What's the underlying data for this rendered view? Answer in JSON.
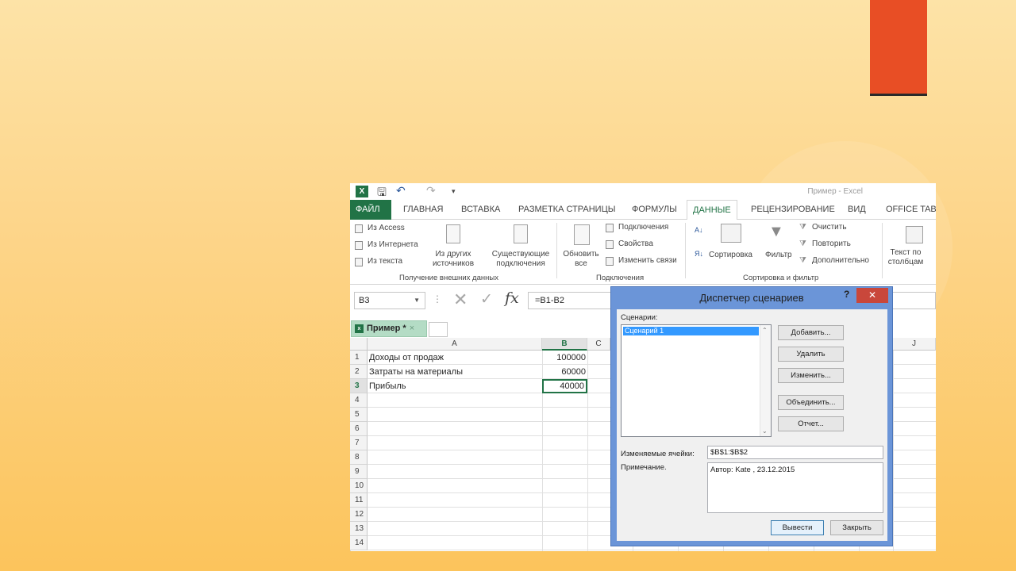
{
  "window": {
    "title": "Пример - Excel"
  },
  "ribbon_tabs": [
    "ФАЙЛ",
    "ГЛАВНАЯ",
    "ВСТАВКА",
    "РАЗМЕТКА СТРАНИЦЫ",
    "ФОРМУЛЫ",
    "ДАННЫЕ",
    "РЕЦЕНЗИРОВАНИЕ",
    "ВИД",
    "OFFICE TAB"
  ],
  "active_tab": "ДАННЫЕ",
  "ribbon": {
    "external": {
      "from_access": "Из Access",
      "from_web": "Из Интернета",
      "from_text": "Из текста",
      "from_other_1": "Из других",
      "from_other_2": "источников",
      "existing_1": "Существующие",
      "existing_2": "подключения",
      "group": "Получение внешних данных"
    },
    "connections": {
      "refresh_1": "Обновить",
      "refresh_2": "все",
      "connections": "Подключения",
      "properties": "Свойства",
      "edit_links": "Изменить связи",
      "group": "Подключения"
    },
    "sort": {
      "sort": "Сортировка",
      "filter": "Фильтр",
      "clear": "Очистить",
      "reapply": "Повторить",
      "advanced": "Дополнительно",
      "group": "Сортировка и фильтр"
    },
    "tools": {
      "text_cols_1": "Текст по",
      "text_cols_2": "столбцам"
    }
  },
  "formula_bar": {
    "name_box": "B3",
    "formula": "=B1-B2"
  },
  "workbook_tab": {
    "label": "Пример *",
    "close": "×"
  },
  "sheet": {
    "columns": [
      "A",
      "B",
      "C",
      "J"
    ],
    "rows": [
      {
        "num": "1",
        "a": "Доходы от продаж",
        "b": "100000"
      },
      {
        "num": "2",
        "a": "Затраты на материалы",
        "b": "60000"
      },
      {
        "num": "3",
        "a": "Прибыль",
        "b": "40000"
      },
      {
        "num": "4",
        "a": "",
        "b": ""
      },
      {
        "num": "5",
        "a": "",
        "b": ""
      },
      {
        "num": "6",
        "a": "",
        "b": ""
      },
      {
        "num": "7",
        "a": "",
        "b": ""
      },
      {
        "num": "8",
        "a": "",
        "b": ""
      },
      {
        "num": "9",
        "a": "",
        "b": ""
      },
      {
        "num": "10",
        "a": "",
        "b": ""
      },
      {
        "num": "11",
        "a": "",
        "b": ""
      },
      {
        "num": "12",
        "a": "",
        "b": ""
      },
      {
        "num": "13",
        "a": "",
        "b": ""
      },
      {
        "num": "14",
        "a": "",
        "b": ""
      }
    ]
  },
  "dialog": {
    "title": "Диспетчер сценариев",
    "help": "?",
    "close": "✕",
    "scenarios_label": "Сценарии:",
    "scenario_items": [
      "Сценарий 1"
    ],
    "buttons": {
      "add": "Добавить...",
      "delete": "Удалить",
      "edit": "Изменить...",
      "merge": "Объединить...",
      "report": "Отчет..."
    },
    "changing_cells_label": "Изменяемые ячейки:",
    "changing_cells_value": "$B$1:$B$2",
    "comment_label": "Примечание.",
    "comment_value": "Автор: Kate , 23.12.2015",
    "show": "Вывести",
    "close_btn": "Закрыть"
  },
  "colors": {
    "accent": "#e84e25",
    "excel_green": "#217346",
    "dialog_frame": "#6b95d8"
  }
}
